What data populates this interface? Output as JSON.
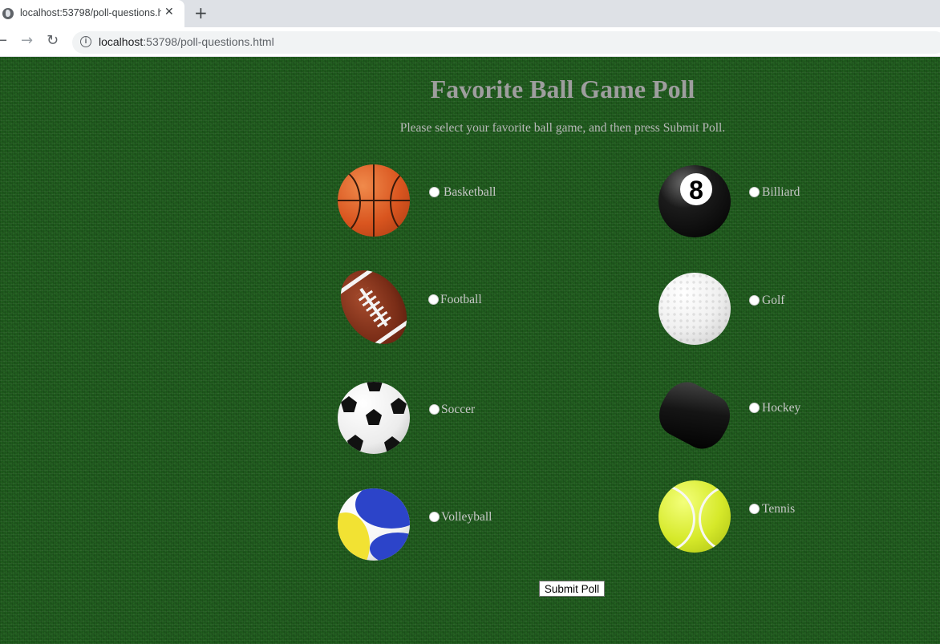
{
  "browser": {
    "tab_title": "localhost:53798/poll-questions.html",
    "new_tab_symbol": "+",
    "close_symbol": "✕",
    "back_symbol": "←",
    "forward_symbol": "→",
    "reload_symbol": "↻",
    "info_symbol": "i",
    "url_host": "localhost",
    "url_rest": ":53798/poll-questions.html"
  },
  "poll": {
    "title": "Favorite Ball Game Poll",
    "subtitle": "Please select your favorite ball game, and then press Submit Poll.",
    "options": [
      {
        "label": "Basketball",
        "icon": "basketball-icon"
      },
      {
        "label": "Billiard",
        "icon": "billiard-ball-icon"
      },
      {
        "label": "Football",
        "icon": "football-icon"
      },
      {
        "label": "Golf",
        "icon": "golf-ball-icon"
      },
      {
        "label": "Soccer",
        "icon": "soccer-ball-icon"
      },
      {
        "label": "Hockey",
        "icon": "hockey-puck-icon"
      },
      {
        "label": "Volleyball",
        "icon": "volleyball-icon"
      },
      {
        "label": "Tennis",
        "icon": "tennis-ball-icon"
      }
    ],
    "billiard_number": "8",
    "submit_label": "Submit Poll"
  },
  "colors": {
    "background": "#1f5b1d",
    "title": "#9e9e9e",
    "label": "#c8c8c8"
  }
}
